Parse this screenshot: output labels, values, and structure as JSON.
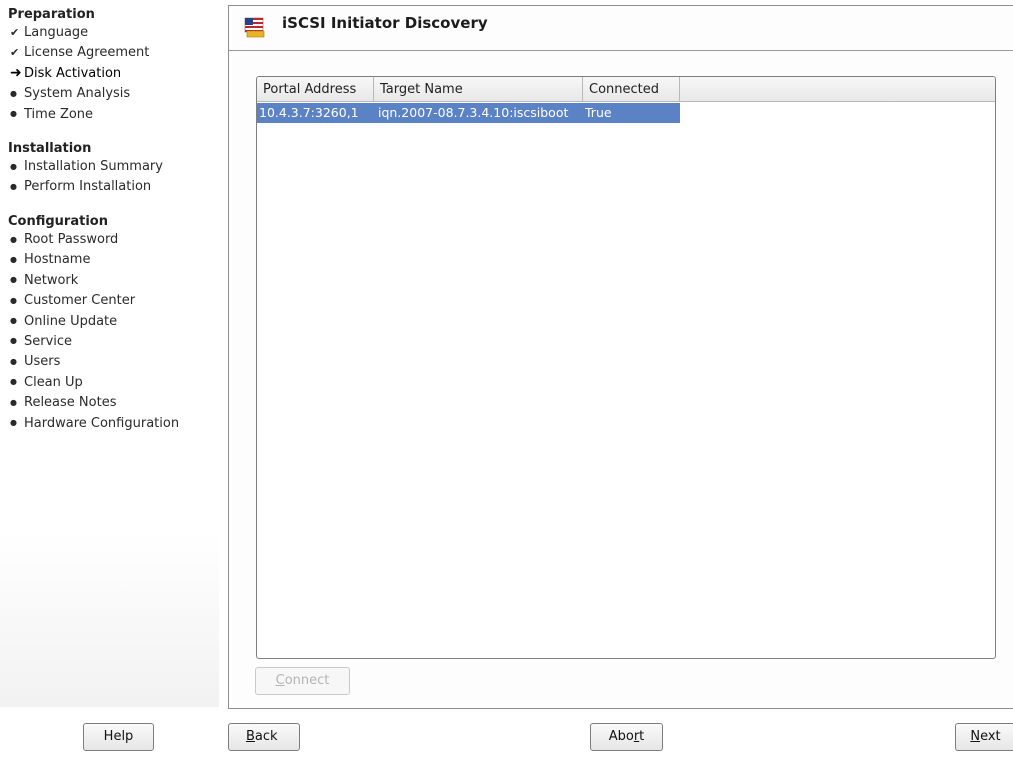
{
  "sidebar": {
    "sections": [
      {
        "title": "Preparation",
        "steps": [
          {
            "label": "Language",
            "state": "done"
          },
          {
            "label": "License Agreement",
            "state": "done"
          },
          {
            "label": "Disk Activation",
            "state": "current"
          },
          {
            "label": "System Analysis",
            "state": "pending"
          },
          {
            "label": "Time Zone",
            "state": "pending"
          }
        ]
      },
      {
        "title": "Installation",
        "steps": [
          {
            "label": "Installation Summary",
            "state": "pending"
          },
          {
            "label": "Perform Installation",
            "state": "pending"
          }
        ]
      },
      {
        "title": "Configuration",
        "steps": [
          {
            "label": "Root Password",
            "state": "pending"
          },
          {
            "label": "Hostname",
            "state": "pending"
          },
          {
            "label": "Network",
            "state": "pending"
          },
          {
            "label": "Customer Center",
            "state": "pending"
          },
          {
            "label": "Online Update",
            "state": "pending"
          },
          {
            "label": "Service",
            "state": "pending"
          },
          {
            "label": "Users",
            "state": "pending"
          },
          {
            "label": "Clean Up",
            "state": "pending"
          },
          {
            "label": "Release Notes",
            "state": "pending"
          },
          {
            "label": "Hardware Configuration",
            "state": "pending"
          }
        ]
      }
    ]
  },
  "header": {
    "title": "iSCSI Initiator Discovery",
    "icon": "us-flag-icon"
  },
  "table": {
    "columns": [
      "Portal Address",
      "Target Name",
      "Connected"
    ],
    "rows": [
      [
        "10.4.3.7:3260,1",
        "iqn.2007-08.7.3.4.10:iscsiboot",
        "True"
      ]
    ],
    "selected_row": 0
  },
  "buttons": {
    "connect": {
      "pre": "",
      "mnemonic": "C",
      "post": "onnect"
    },
    "help": {
      "pre": "Help",
      "mnemonic": "",
      "post": ""
    },
    "back": {
      "pre": "",
      "mnemonic": "B",
      "post": "ack"
    },
    "abort": {
      "pre": "Abo",
      "mnemonic": "r",
      "post": "t"
    },
    "next": {
      "pre": "",
      "mnemonic": "N",
      "post": "ext"
    }
  },
  "colors": {
    "selection": "#5b82c5",
    "border": "#8e8e8e"
  }
}
